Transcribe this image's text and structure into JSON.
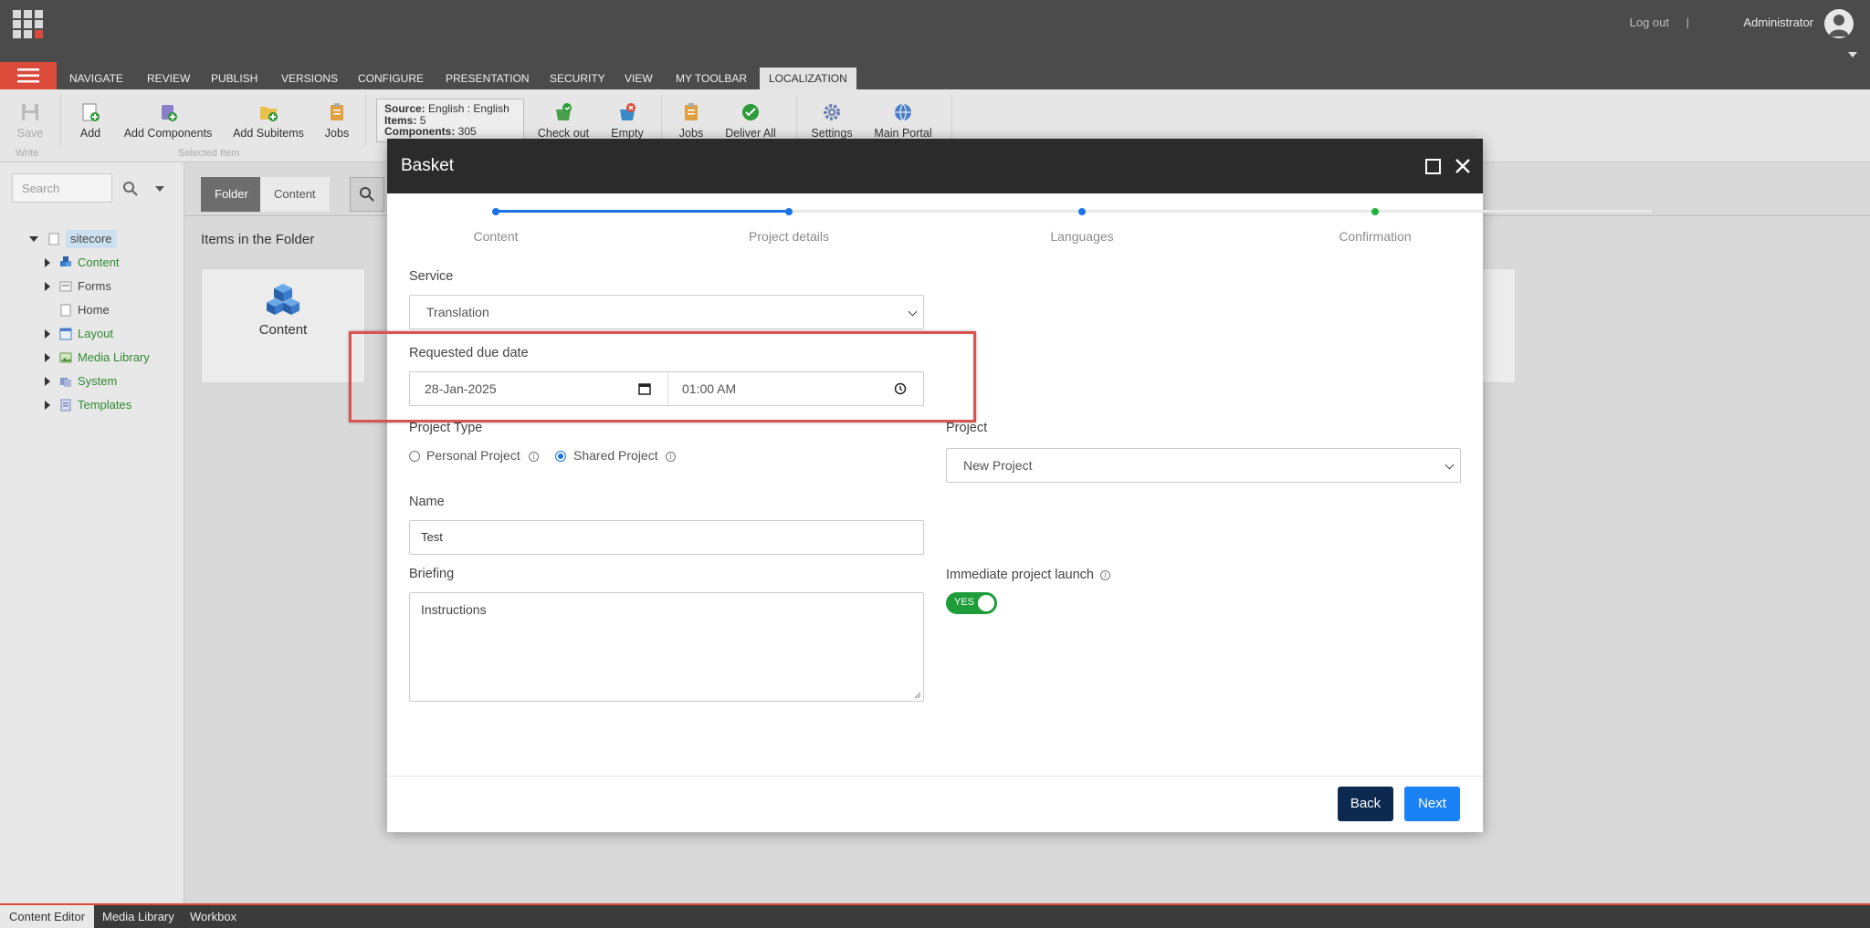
{
  "topbar": {
    "logout": "Log out",
    "separator": "|",
    "user": "Administrator"
  },
  "ribbon_tabs": [
    "NAVIGATE",
    "REVIEW",
    "PUBLISH",
    "VERSIONS",
    "CONFIGURE",
    "PRESENTATION",
    "SECURITY",
    "VIEW",
    "MY TOOLBAR",
    "LOCALIZATION"
  ],
  "ribbon": {
    "save": "Save",
    "write_group": "Write",
    "add": "Add",
    "add_components": "Add Components",
    "add_subitems": "Add Subitems",
    "jobs": "Jobs",
    "selected_item_group": "Selected Item",
    "source_label": "Source:",
    "source_value": "English : English",
    "items_label": "Items:",
    "items_value": "5",
    "components_label": "Components:",
    "components_value": "305",
    "check_out": "Check out",
    "empty": "Empty",
    "jobs2": "Jobs",
    "deliver_all": "Deliver All",
    "settings": "Settings",
    "main_portal": "Main Portal"
  },
  "leftpanel": {
    "search_placeholder": "Search",
    "tree": [
      {
        "label": "sitecore"
      },
      {
        "label": "Content"
      },
      {
        "label": "Forms"
      },
      {
        "label": "Home"
      },
      {
        "label": "Layout"
      },
      {
        "label": "Media Library"
      },
      {
        "label": "System"
      },
      {
        "label": "Templates"
      }
    ]
  },
  "main": {
    "tab_folder": "Folder",
    "tab_content": "Content",
    "items_title": "Items in the Folder",
    "card_label": "Content"
  },
  "bottom_tabs": [
    "Content Editor",
    "Media Library",
    "Workbox"
  ],
  "dialog": {
    "title": "Basket",
    "steps": [
      "Content",
      "Project details",
      "Languages",
      "Confirmation"
    ],
    "service_label": "Service",
    "service_value": "Translation",
    "due_label": "Requested due date",
    "due_date": "28-Jan-2025",
    "due_time": "01:00 AM",
    "project_type_label": "Project Type",
    "personal_project": "Personal Project",
    "shared_project": "Shared Project",
    "project_label": "Project",
    "project_value": "New Project",
    "name_label": "Name",
    "name_value": "Test",
    "briefing_label": "Briefing",
    "briefing_value": "Instructions",
    "launch_label": "Immediate project launch",
    "launch_toggle": "YES",
    "back": "Back",
    "next": "Next"
  },
  "colors": {
    "accent_red": "#dc4a3a",
    "step_blue": "#1a73e8",
    "step_green": "#1fb53f",
    "toggle_green": "#1f9d3a",
    "btn_back": "#0c2a4f",
    "btn_next": "#1a82f5",
    "highlight": "#d9534f"
  }
}
